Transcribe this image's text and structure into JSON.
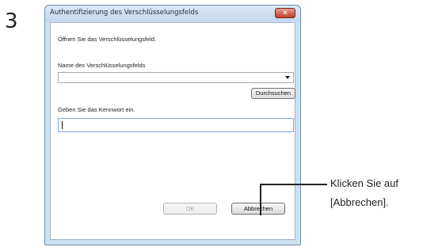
{
  "step": "3",
  "dialog": {
    "title": "Authentifizierung des Verschlüsselungsfelds",
    "instruction": "Öffnen Sie das Verschlüsselungsfeld.",
    "name_label": "Name des Verschlüsselungsfelds",
    "name_value": "",
    "browse_label": "Durchsuchen",
    "password_label": "Geben Sie das Kennwort ein.",
    "password_value": "",
    "ok_label": "OK",
    "cancel_label": "Abbrechen"
  },
  "annotation": {
    "line1": "Klicken Sie auf",
    "line2": "[Abbrechen]."
  }
}
